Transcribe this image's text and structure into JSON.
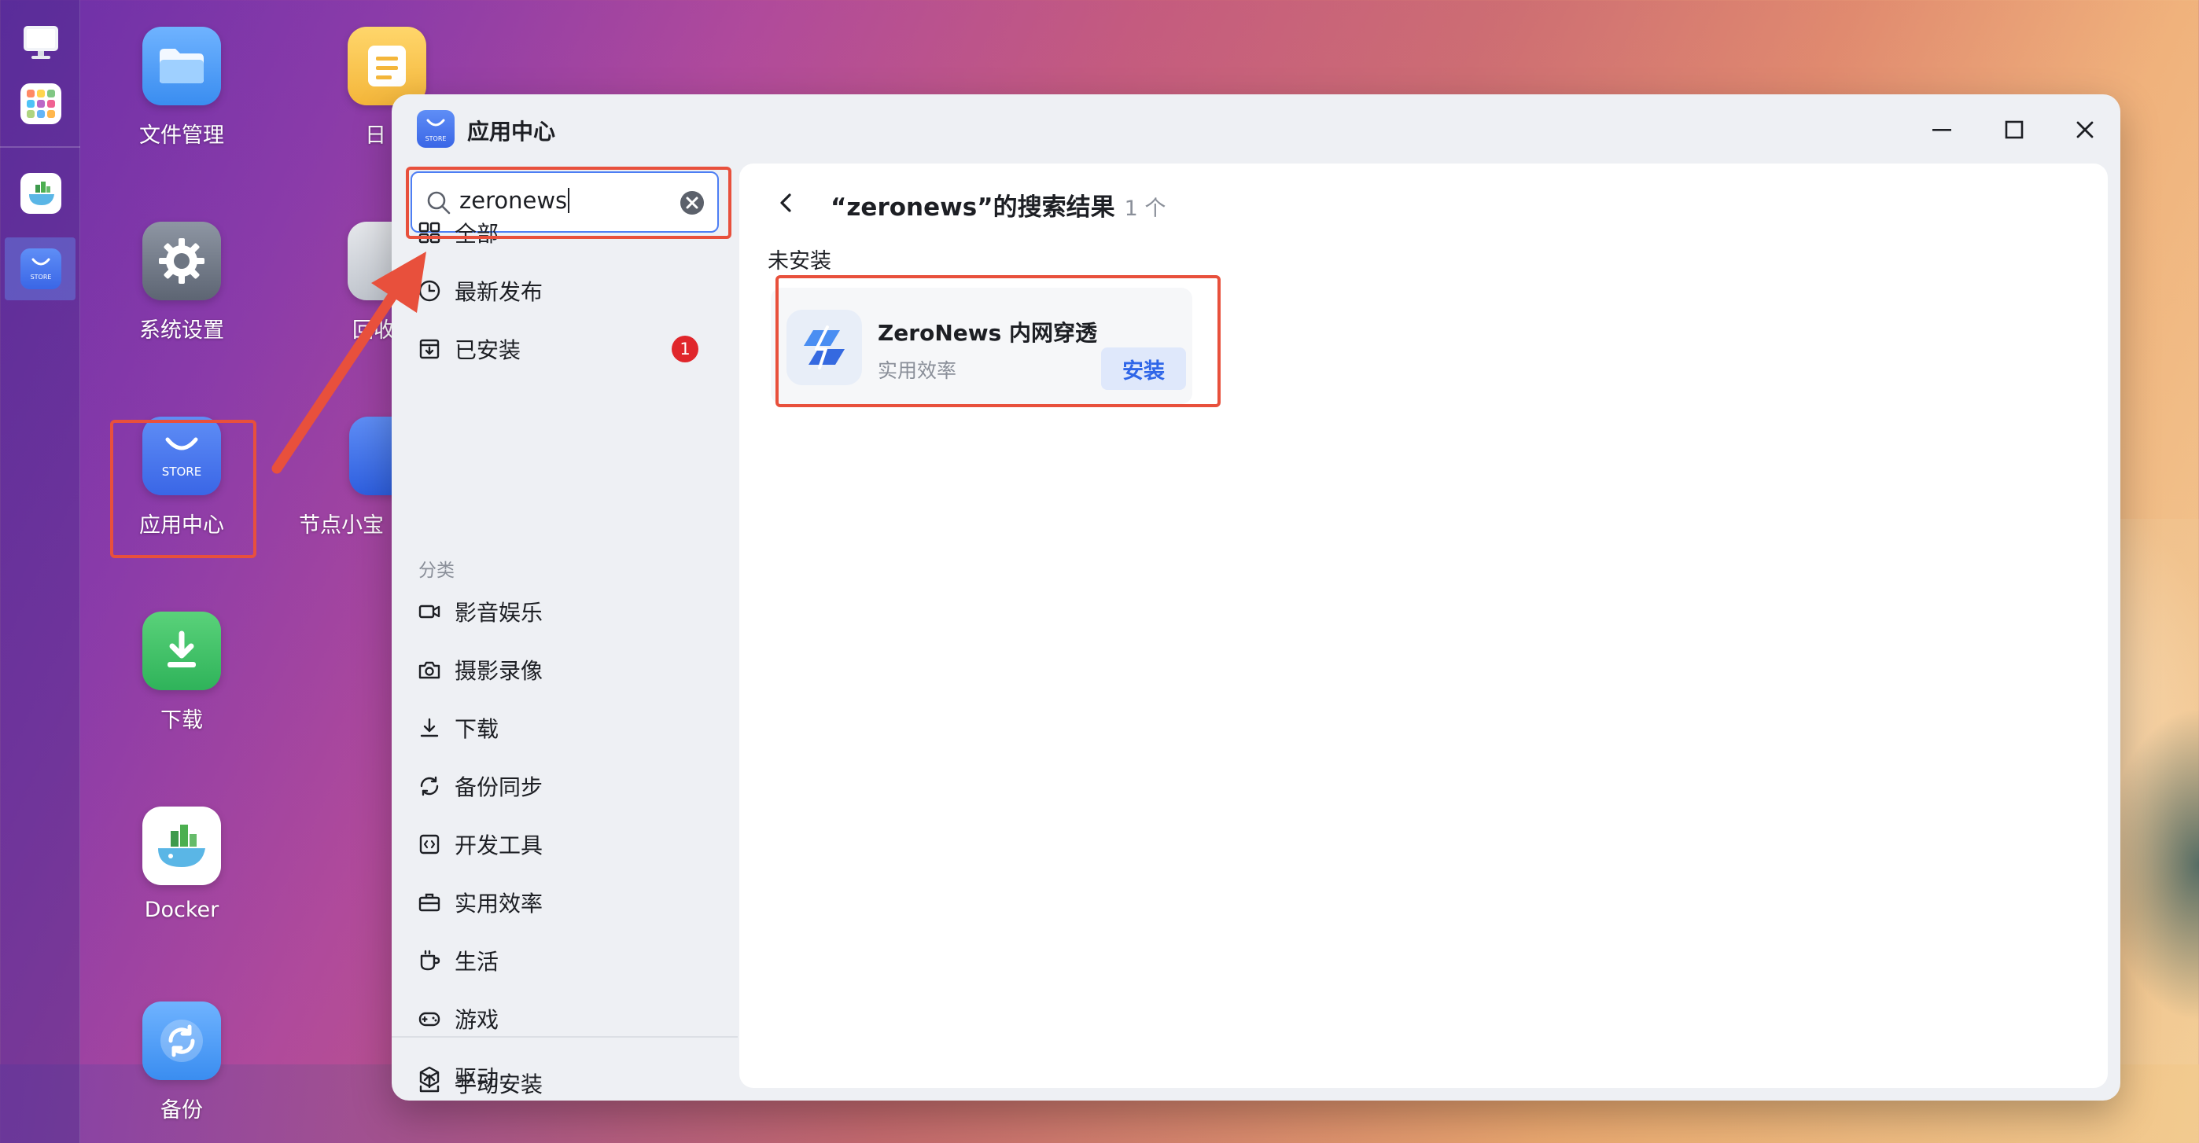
{
  "desktop": {
    "icons": [
      {
        "label": "文件管理"
      },
      {
        "label": "系统设置"
      },
      {
        "label": "应用中心",
        "sublabel": "STORE"
      },
      {
        "label": "下载"
      },
      {
        "label": "Docker"
      },
      {
        "label": "备份"
      },
      {
        "label": "日"
      },
      {
        "label": "回收"
      },
      {
        "label": "节点小宝"
      }
    ]
  },
  "dock": {
    "items": [
      {
        "name": "monitor"
      },
      {
        "name": "app-grid"
      },
      {
        "name": "docker"
      },
      {
        "name": "store",
        "label": "STORE"
      }
    ]
  },
  "window": {
    "title": "应用中心",
    "logo_label": "STORE"
  },
  "sidebar": {
    "search": {
      "value": "zeronews"
    },
    "items": [
      {
        "label": "全部"
      },
      {
        "label": "最新发布"
      },
      {
        "label": "已安装",
        "badge": "1"
      }
    ],
    "category_header": "分类",
    "categories": [
      {
        "label": "影音娱乐"
      },
      {
        "label": "摄影录像"
      },
      {
        "label": "下载"
      },
      {
        "label": "备份同步"
      },
      {
        "label": "开发工具"
      },
      {
        "label": "实用效率"
      },
      {
        "label": "生活"
      },
      {
        "label": "游戏"
      },
      {
        "label": "驱动"
      }
    ],
    "manual_install": "手动安装"
  },
  "main": {
    "result_title": "“zeronews”的搜索结果",
    "result_count": "1 个",
    "section": "未安装",
    "app": {
      "name": "ZeroNews 内网穿透",
      "category": "实用效率",
      "action": "安装"
    }
  },
  "colors": {
    "accent": "#3a6ae8",
    "annotation": "#e8503c",
    "badge": "#e0262b"
  }
}
